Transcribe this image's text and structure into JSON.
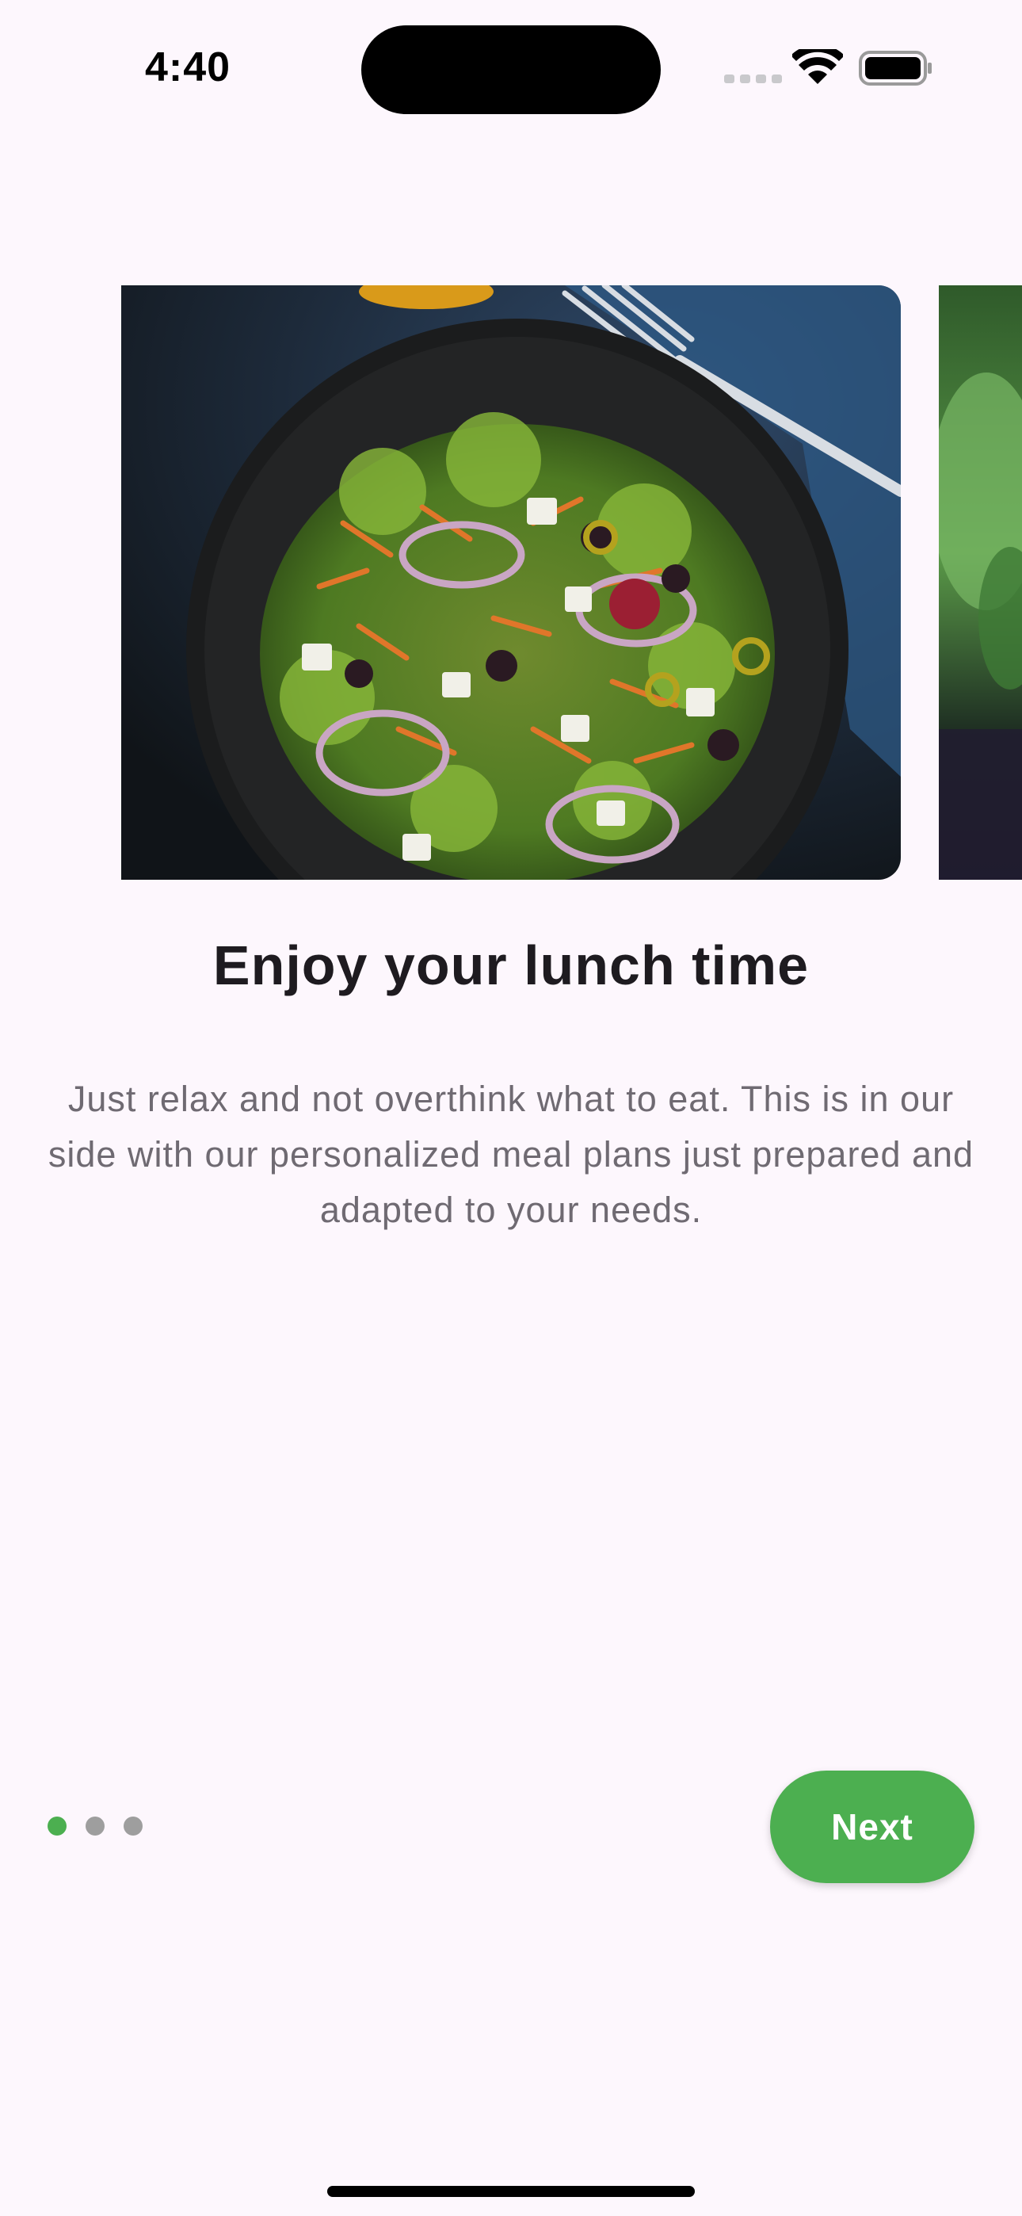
{
  "status_bar": {
    "time": "4:40"
  },
  "onboarding": {
    "title": "Enjoy your lunch time",
    "description": "Just relax and not overthink what to eat. This is in our side with our personalized meal plans just prepared and adapted to your needs.",
    "slide_image": "salad-bowl-photo",
    "next_slide_image": "green-plant-photo",
    "page_count": 3,
    "current_page": 1,
    "next_label": "Next"
  },
  "colors": {
    "accent": "#4caf50",
    "background": "#fdf7fd",
    "title_text": "#1e1b20",
    "body_text": "#6f6a72",
    "inactive_dot": "#9e9e9e"
  }
}
